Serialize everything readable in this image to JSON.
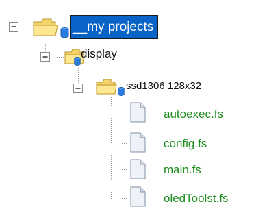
{
  "tree": {
    "root": {
      "label": "__my projects",
      "icon": "folder-icon",
      "badge": "db-icon",
      "expanded": true,
      "selected": true
    },
    "display": {
      "label": "display",
      "icon": "folder-icon",
      "badge": "db-icon",
      "expanded": true
    },
    "ssd": {
      "label": "ssd1306 128x32",
      "icon": "folder-icon",
      "badge": "db-icon",
      "expanded": true
    },
    "files": [
      {
        "label": "autoexec.fs",
        "icon": "file-icon"
      },
      {
        "label": "config.fs",
        "icon": "file-icon"
      },
      {
        "label": "main.fs",
        "icon": "file-icon"
      },
      {
        "label": "oledToolst.fs",
        "icon": "file-icon"
      }
    ]
  },
  "colors": {
    "selection_bg": "#0a64c8",
    "selection_text": "#ffffff",
    "file_text": "#1e8e1e",
    "folder_fill": "#f4d36a",
    "badge": "#2a7de0"
  }
}
